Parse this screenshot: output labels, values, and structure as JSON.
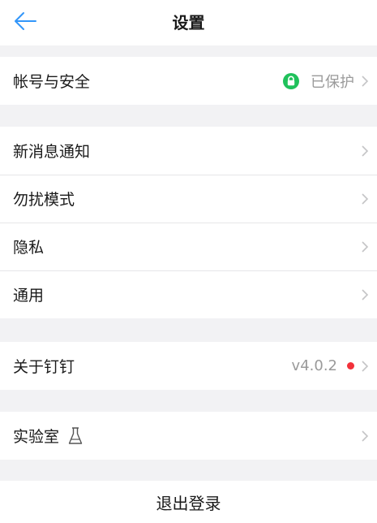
{
  "header": {
    "title": "设置",
    "back_icon": "arrow-left-icon",
    "accent_color": "#3296fa"
  },
  "groups": [
    {
      "items": [
        {
          "label": "帐号与安全",
          "value": "已保护",
          "icon": "lock-icon",
          "icon_color": "#1fc15b"
        }
      ]
    },
    {
      "items": [
        {
          "label": "新消息通知"
        },
        {
          "label": "勿扰模式"
        },
        {
          "label": "隐私"
        },
        {
          "label": "通用"
        }
      ]
    },
    {
      "items": [
        {
          "label": "关于钉钉",
          "value": "v4.0.2",
          "badge_color": "#f2313a"
        }
      ]
    },
    {
      "items": [
        {
          "label": "实验室",
          "icon": "flask-icon"
        }
      ]
    }
  ],
  "logout_label": "退出登录"
}
